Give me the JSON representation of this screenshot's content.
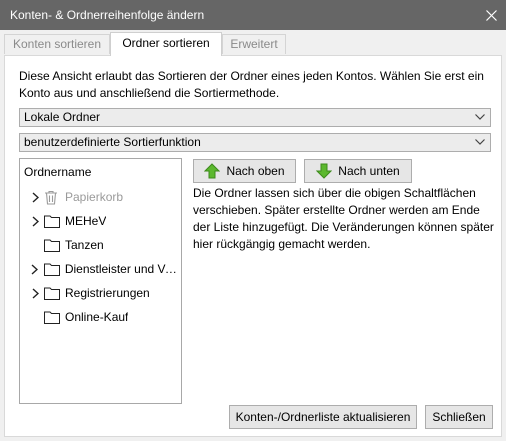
{
  "window": {
    "title": "Konten- & Ordnerreihenfolge ändern"
  },
  "tabs": [
    {
      "label": "Konten sortieren",
      "active": false
    },
    {
      "label": "Ordner sortieren",
      "active": true
    },
    {
      "label": "Erweitert",
      "active": false
    }
  ],
  "intro_text": "Diese Ansicht erlaubt das Sortieren der Ordner eines jeden Kontos. Wählen Sie erst ein Konto aus und anschließend die Sortiermethode.",
  "account_select": {
    "value": "Lokale Ordner"
  },
  "sort_select": {
    "value": "benutzerdefinierte Sortierfunktion"
  },
  "tree": {
    "header": "Ordnername",
    "items": [
      {
        "label": "Papierkorb",
        "icon": "trash-icon",
        "expandable": true,
        "disabled": true
      },
      {
        "label": "MEHeV",
        "icon": "folder-icon",
        "expandable": true,
        "disabled": false
      },
      {
        "label": "Tanzen",
        "icon": "folder-icon",
        "expandable": false,
        "disabled": false
      },
      {
        "label": "Dienstleister und Ve...",
        "icon": "folder-icon",
        "expandable": true,
        "disabled": false
      },
      {
        "label": "Registrierungen",
        "icon": "folder-icon",
        "expandable": true,
        "disabled": false
      },
      {
        "label": "Online-Kauf",
        "icon": "folder-icon",
        "expandable": false,
        "disabled": false
      }
    ]
  },
  "buttons": {
    "move_up": "Nach oben",
    "move_down": "Nach unten",
    "refresh": "Konten-/Ordnerliste aktualisieren",
    "close": "Schließen"
  },
  "help_text": "Die Ordner lassen sich über die obigen Schaltflächen verschieben. Später erstellte Ordner werden am Ende der Liste hinzugefügt. Die Veränderungen können später hier rückgängig gemacht werden.",
  "colors": {
    "titlebar": "#666666",
    "arrow_green": "#5cb82e"
  }
}
